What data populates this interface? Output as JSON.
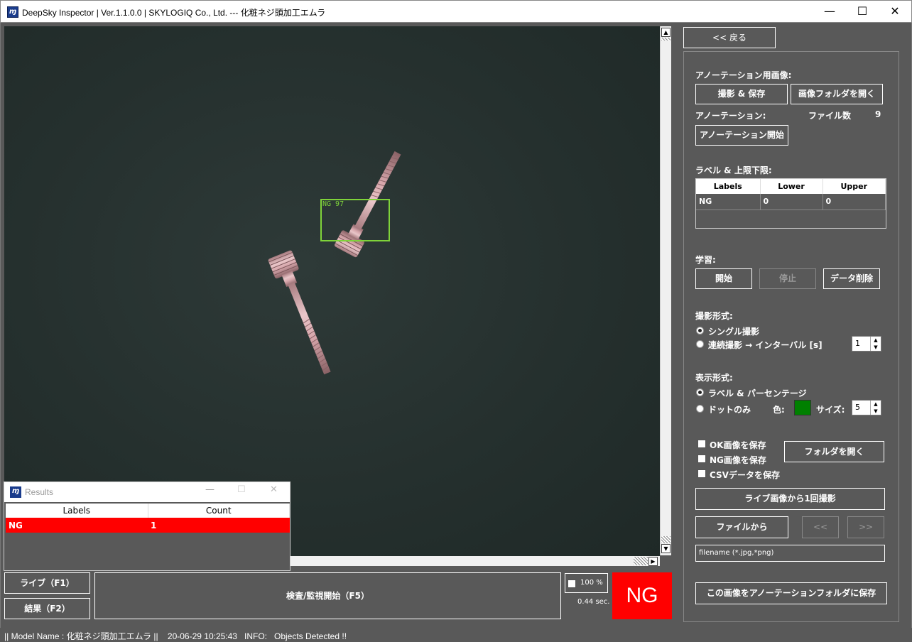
{
  "window": {
    "title": "DeepSky Inspector | Ver.1.1.0.0 | SKYLOGIQ Co., Ltd. --- 化粧ネジ頭加工エムラ",
    "minimize": "—",
    "maximize": "☐",
    "close": "✕"
  },
  "viewer": {
    "detection_label": "NG 97"
  },
  "results": {
    "title": "Results",
    "columns": [
      "Labels",
      "Count"
    ],
    "rows": [
      {
        "label": "NG",
        "count": "1"
      }
    ]
  },
  "bottom": {
    "live_button": "ライブ（F1）",
    "result_button": "結果（F2）",
    "inspect_button": "検査/監視開始（F5）",
    "zoom_label": "100 %",
    "time_label": "0.44 sec.",
    "verdict": "NG",
    "verdict_color": "#ff0000"
  },
  "panel": {
    "back_button": "<< 戻る",
    "annotation_image_label": "アノーテーション用画像:",
    "capture_save_button": "撮影 & 保存",
    "open_image_folder_button": "画像フォルダを開く",
    "annotation_label": "アノーテーション:",
    "file_count_label": "ファイル数",
    "file_count_value": "9",
    "annotation_start_button": "アノーテーション開始",
    "label_limits_label": "ラベル & 上限下限:",
    "label_table": {
      "columns": [
        "Labels",
        "Lower",
        "Upper"
      ],
      "rows": [
        {
          "label": "NG",
          "lower": "0",
          "upper": "0"
        }
      ]
    },
    "learning_label": "学習:",
    "start_button": "開始",
    "stop_button": "停止",
    "delete_data_button": "データ削除",
    "capture_mode_label": "撮影形式:",
    "single_capture": "シングル撮影",
    "continuous_capture": "連続撮影 → インターバル [s]",
    "interval_value": "1",
    "display_mode_label": "表示形式:",
    "label_percentage": "ラベル & パーセンテージ",
    "dots_only": "ドットのみ",
    "color_label": "色:",
    "dot_color": "#008000",
    "size_label": "サイズ:",
    "size_value": "5",
    "save_ok_images": "OK画像を保存",
    "save_ng_images": "NG画像を保存",
    "save_csv": "CSVデータを保存",
    "open_folder_button": "フォルダを開く",
    "capture_once_button": "ライブ画像から1回撮影",
    "from_file_button": "ファイルから",
    "prev_button": "<<",
    "next_button": ">>",
    "filename_placeholder": "filename (*.jpg,*png)",
    "save_to_annotation_button": "この画像をアノーテーションフォルダに保存"
  },
  "status": {
    "text": "|| Model Name : 化粧ネジ頭加工エムラ ||    20-06-29 10:25:43   INFO:   Objects Detected !!"
  }
}
